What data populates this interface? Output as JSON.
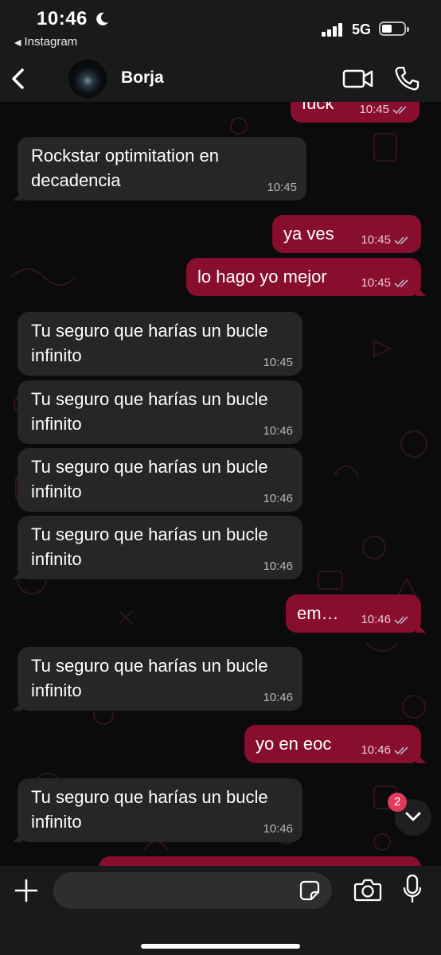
{
  "status_bar": {
    "time": "10:46",
    "back_app": "Instagram",
    "network": "5G",
    "moon_icon": "moon-icon",
    "battery_level": 0.45
  },
  "header": {
    "contact_name": "Borja"
  },
  "messages": [
    {
      "dir": "out",
      "text": "fuck",
      "time": "10:45"
    },
    {
      "dir": "in",
      "text": "Rockstar optimitation en decadencia",
      "time": "10:45"
    },
    {
      "dir": "out",
      "text": "ya ves",
      "time": "10:45"
    },
    {
      "dir": "out",
      "text": "lo hago yo mejor",
      "time": "10:45"
    },
    {
      "dir": "in",
      "text": "Tu seguro que harías un bucle infinito",
      "time": "10:45"
    },
    {
      "dir": "in",
      "text": "Tu seguro que harías un bucle infinito",
      "time": "10:46"
    },
    {
      "dir": "in",
      "text": "Tu seguro que harías un bucle infinito",
      "time": "10:46"
    },
    {
      "dir": "in",
      "text": "Tu seguro que harías un bucle infinito",
      "time": "10:46"
    },
    {
      "dir": "out",
      "text": "em…",
      "time": "10:46"
    },
    {
      "dir": "in",
      "text": "Tu seguro que harías un bucle infinito",
      "time": "10:46"
    },
    {
      "dir": "out",
      "text": "yo en eoc",
      "time": "10:46"
    },
    {
      "dir": "in",
      "text": "Tu seguro que harías un bucle infinito",
      "time": "10:46"
    }
  ],
  "scroll": {
    "unread_count": "2"
  },
  "composer": {
    "placeholder": ""
  },
  "colors": {
    "outgoing_bubble": "#880e2e",
    "incoming_bubble": "#262626",
    "badge": "#e23b5a"
  }
}
